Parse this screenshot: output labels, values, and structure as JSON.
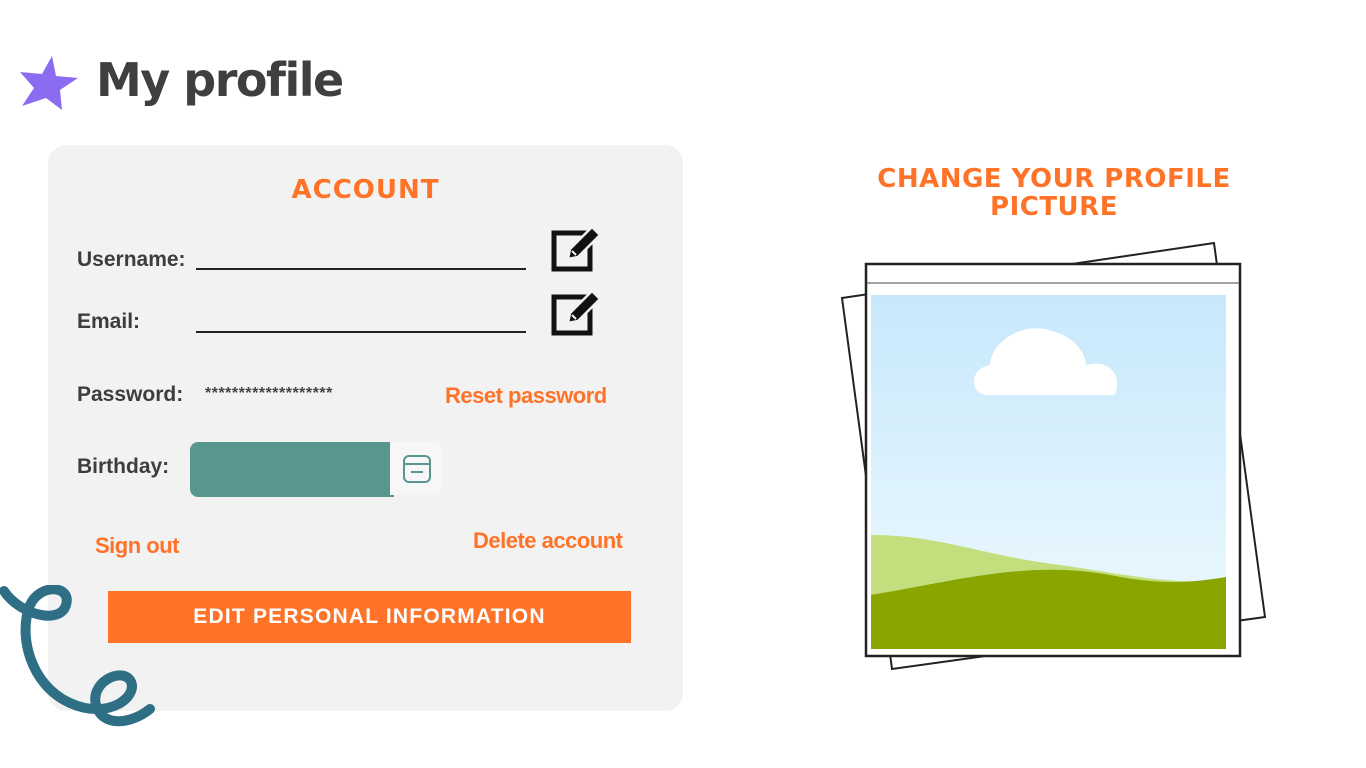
{
  "header": {
    "title": "My profile",
    "icon": "star-icon"
  },
  "account": {
    "title": "ACCOUNT",
    "username_label": "Username:",
    "username_value": "",
    "email_label": "Email:",
    "email_value": "",
    "password_label": "Password:",
    "password_value": "*******************",
    "reset_password": "Reset password",
    "birthday_label": "Birthday:",
    "birthday_value": "",
    "sign_out": "Sign out",
    "delete_account": "Delete account",
    "edit_button": "EDIT PERSONAL INFORMATION"
  },
  "profile_picture": {
    "heading": "CHANGE YOUR PROFILE PICTURE",
    "icon": "image-placeholder-icon"
  },
  "colors": {
    "accent": "#ff7328",
    "title_text": "#3f3f3f",
    "card_bg": "#f2f2f2",
    "date_field": "#59968f",
    "star": "#8b6cf0",
    "squiggle": "#2f6f86"
  }
}
